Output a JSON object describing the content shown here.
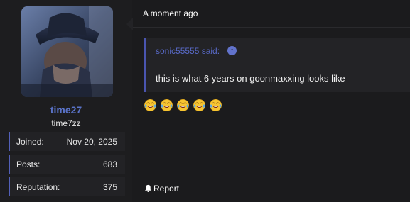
{
  "user": {
    "username": "time27",
    "title": "time7zz",
    "stats": [
      {
        "label": "Joined:",
        "value": "Nov 20, 2025"
      },
      {
        "label": "Posts:",
        "value": "683"
      },
      {
        "label": "Reputation:",
        "value": "375"
      }
    ]
  },
  "post": {
    "timestamp": "A moment ago",
    "quote": {
      "author_line": "sonic55555 said:",
      "jump_icon": "arrow-up-circle-icon",
      "text": "this is what 6 years on goonmaxxing looks like"
    },
    "emoji": "face-with-tears-of-joy",
    "emoji_count": 5,
    "report_label": "Report",
    "report_icon": "bell-icon"
  },
  "colors": {
    "background": "#1b1b1d",
    "username": "#5a73c9",
    "accent": "#4a55b0",
    "quote_bg": "#232326"
  }
}
